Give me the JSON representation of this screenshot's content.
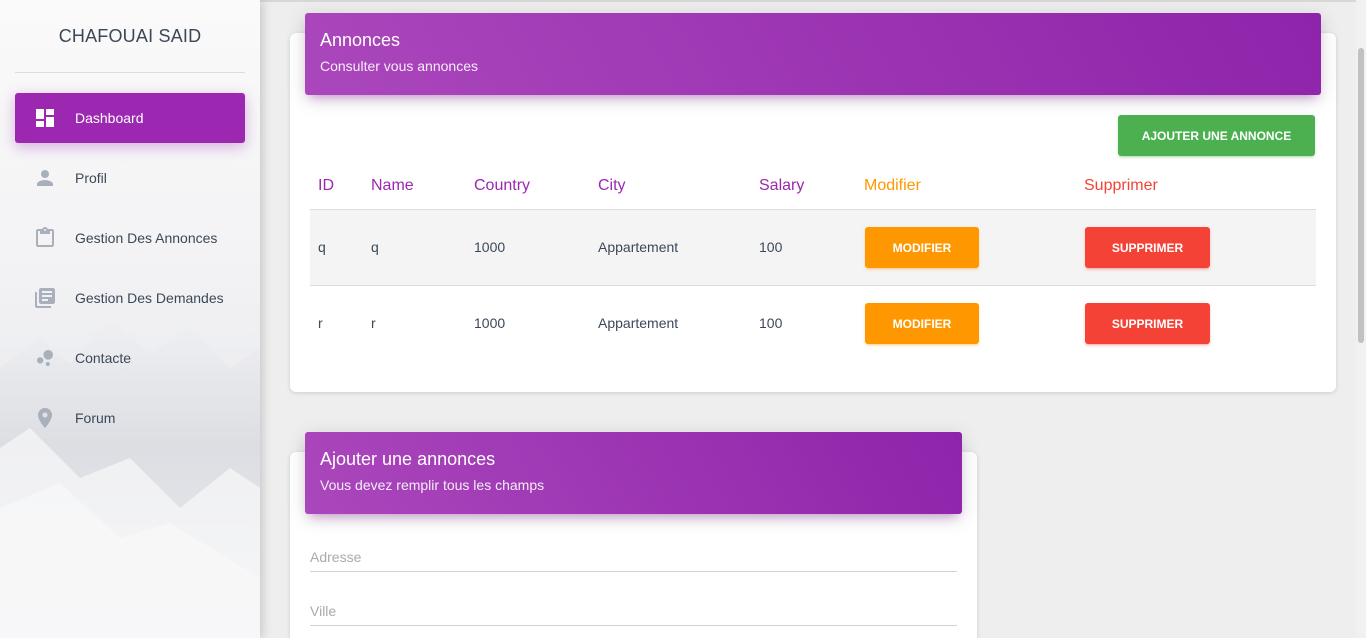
{
  "sidebar": {
    "brand": "CHAFOUAI SAID",
    "items": [
      {
        "label": "Dashboard",
        "icon": "dashboard-icon",
        "active": true
      },
      {
        "label": "Profil",
        "icon": "person-icon",
        "active": false
      },
      {
        "label": "Gestion Des Annonces",
        "icon": "clipboard-icon",
        "active": false
      },
      {
        "label": "Gestion Des Demandes",
        "icon": "library-books-icon",
        "active": false
      },
      {
        "label": "Contacte",
        "icon": "bubble-chart-icon",
        "active": false
      },
      {
        "label": "Forum",
        "icon": "location-pin-icon",
        "active": false
      }
    ]
  },
  "annonces": {
    "title": "Annonces",
    "subtitle": "Consulter vous annonces",
    "add_button": "AJOUTER UNE ANNONCE",
    "columns": [
      "ID",
      "Name",
      "Country",
      "City",
      "Salary",
      "Modifier",
      "Supprimer"
    ],
    "rows": [
      {
        "id": "q",
        "name": "q",
        "country": "1000",
        "city": "Appartement",
        "salary": "100",
        "modifier": "MODIFIER",
        "supprimer": "SUPPRIMER"
      },
      {
        "id": "r",
        "name": "r",
        "country": "1000",
        "city": "Appartement",
        "salary": "100",
        "modifier": "MODIFIER",
        "supprimer": "SUPPRIMER"
      }
    ]
  },
  "ajouter": {
    "title": "Ajouter une annonces",
    "subtitle": "Vous devez remplir tous les champs",
    "fields": [
      {
        "placeholder": "Adresse",
        "value": ""
      },
      {
        "placeholder": "Ville",
        "value": ""
      }
    ]
  },
  "colors": {
    "primary": "#9c27b0",
    "success": "#4caf50",
    "warning": "#ff9800",
    "danger": "#f44336"
  }
}
